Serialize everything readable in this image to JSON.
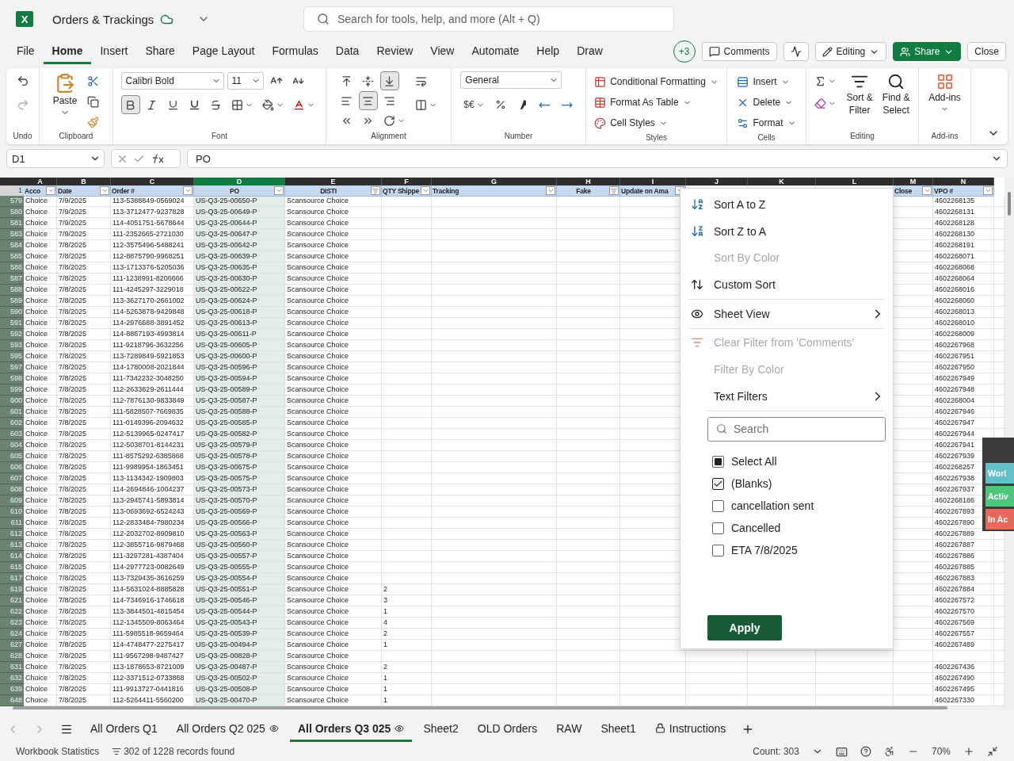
{
  "app": {
    "logo": "X",
    "title": "Orders & Trackings"
  },
  "search": {
    "placeholder": "Search for tools, help, and more (Alt + Q)"
  },
  "menu_tabs": [
    {
      "label": "File",
      "selected": false
    },
    {
      "label": "Home",
      "selected": true
    },
    {
      "label": "Insert",
      "selected": false
    },
    {
      "label": "Share",
      "selected": false
    },
    {
      "label": "Page Layout",
      "selected": false
    },
    {
      "label": "Formulas",
      "selected": false
    },
    {
      "label": "Data",
      "selected": false
    },
    {
      "label": "Review",
      "selected": false
    },
    {
      "label": "View",
      "selected": false
    },
    {
      "label": "Automate",
      "selected": false
    },
    {
      "label": "Help",
      "selected": false
    },
    {
      "label": "Draw",
      "selected": false
    }
  ],
  "actions": {
    "presence": "+3",
    "comments": "Comments",
    "editing": "Editing",
    "share": "Share",
    "close": "Close"
  },
  "ribbon": {
    "undo": {
      "label": "Undo"
    },
    "clipboard": {
      "paste": "Paste",
      "label": "Clipboard"
    },
    "font": {
      "name": "Calibri Bold",
      "size": "11",
      "bold": true,
      "label": "Font"
    },
    "alignment": {
      "vertical": [
        {
          "selected": false
        },
        {
          "selected": false
        },
        {
          "selected": true
        }
      ],
      "horizontal": [
        {
          "selected": false
        },
        {
          "selected": true
        },
        {
          "selected": false
        }
      ],
      "label": "Alignment"
    },
    "number": {
      "format": "General",
      "currency": "$€",
      "label": "Number"
    },
    "styles": {
      "items": [
        "Conditional Formatting",
        "Format As Table",
        "Cell Styles"
      ],
      "label": "Styles"
    },
    "cells": {
      "items": [
        "Insert",
        "Delete",
        "Format"
      ],
      "label": "Cells"
    },
    "editing": {
      "sort": [
        "Sort &",
        "Filter"
      ],
      "find": [
        "Find &",
        "Select"
      ],
      "label": "Editing"
    },
    "addins": {
      "button": "Add-ins",
      "label": "Add-ins"
    }
  },
  "formula_bar": {
    "name_box": "D1",
    "value": "PO"
  },
  "sheet": {
    "column_letters": [
      {
        "label": "A",
        "selected": false
      },
      {
        "label": "B",
        "selected": false
      },
      {
        "label": "C",
        "selected": false
      },
      {
        "label": "D",
        "selected": true
      },
      {
        "label": "E",
        "selected": false
      },
      {
        "label": "F",
        "selected": false
      },
      {
        "label": "G",
        "selected": false
      },
      {
        "label": "H",
        "selected": false
      },
      {
        "label": "I",
        "selected": false
      },
      {
        "label": "J",
        "selected": false
      },
      {
        "label": "K",
        "selected": false
      },
      {
        "label": "L",
        "selected": false
      },
      {
        "label": "M",
        "selected": false
      },
      {
        "label": "N",
        "selected": false
      }
    ],
    "header_row": "1",
    "headers": [
      {
        "kind": "text",
        "label": "Acco",
        "filtered": false
      },
      {
        "kind": "text",
        "label": "Date",
        "filtered": false
      },
      {
        "kind": "text",
        "label": "Order #",
        "filtered": false
      },
      {
        "kind": "text",
        "label": "PO",
        "filtered": false
      },
      {
        "kind": "text",
        "label": "DISTI",
        "filtered": true
      },
      {
        "kind": "text",
        "label": "QTY Shippe",
        "filtered": false
      },
      {
        "kind": "text",
        "label": "Tracking",
        "filtered": false
      },
      {
        "kind": "text",
        "label": "Fake",
        "filtered": true
      },
      {
        "kind": "text",
        "label": "Update on Ama",
        "filtered": false
      },
      {
        "kind": "covered"
      },
      {
        "kind": "covered"
      },
      {
        "kind": "covered"
      },
      {
        "kind": "text",
        "label": "Close",
        "filtered": false
      },
      {
        "kind": "text",
        "label": "VPO #",
        "filtered": false
      }
    ],
    "rows": [
      {
        "row": "579",
        "account": "Choice",
        "date": "7/9/2025",
        "order": "113-5388849-0569024",
        "po": "US-Q3-25-00650-P",
        "disti": "Scansource Choice",
        "vpo": "4602268135"
      },
      {
        "row": "580",
        "account": "Choice",
        "date": "7/9/2025",
        "order": "113-3712477-9237828",
        "po": "US-Q3-25-00649-P",
        "disti": "Scansource Choice",
        "vpo": "4602268131"
      },
      {
        "row": "581",
        "account": "Choice",
        "date": "7/9/2025",
        "order": "114-4051751-5678644",
        "po": "US-Q3-25-00644-P",
        "disti": "Scansource Choice",
        "vpo": "4602268128"
      },
      {
        "row": "583",
        "account": "Choice",
        "date": "7/9/2025",
        "order": "111-2352665-2721030",
        "po": "US-Q3-25-00647-P",
        "disti": "Scansource Choice",
        "vpo": "4602268130"
      },
      {
        "row": "584",
        "account": "Choice",
        "date": "7/8/2025",
        "order": "112-3575496-5488241",
        "po": "US-Q3-25-00642-P",
        "disti": "Scansource Choice",
        "vpo": "4602268191"
      },
      {
        "row": "585",
        "account": "Choice",
        "date": "7/8/2025",
        "order": "112-8875790-9968251",
        "po": "US-Q3-25-00639-P",
        "disti": "Scansource Choice",
        "vpo": "4602268071"
      },
      {
        "row": "586",
        "account": "Choice",
        "date": "7/8/2025",
        "order": "113-1713376-5205036",
        "po": "US-Q3-25-00635-P",
        "disti": "Scansource Choice",
        "vpo": "4602268068"
      },
      {
        "row": "587",
        "account": "Choice",
        "date": "7/8/2025",
        "order": "111-1238991-8206666",
        "po": "US-Q3-25-00630-P",
        "disti": "Scansource Choice",
        "vpo": "4602268064"
      },
      {
        "row": "588",
        "account": "Choice",
        "date": "7/8/2025",
        "order": "111-4245297-3229018",
        "po": "US-Q3-25-00622-P",
        "disti": "Scansource Choice",
        "vpo": "4602268016"
      },
      {
        "row": "589",
        "account": "Choice",
        "date": "7/8/2025",
        "order": "113-3627170-2661002",
        "po": "US-Q3-25-00624-P",
        "disti": "Scansource Choice",
        "vpo": "4602268060"
      },
      {
        "row": "590",
        "account": "Choice",
        "date": "7/8/2025",
        "order": "114-5263878-9429848",
        "po": "US-Q3-25-00618-P",
        "disti": "Scansource Choice",
        "vpo": "4602268013"
      },
      {
        "row": "591",
        "account": "Choice",
        "date": "7/8/2025",
        "order": "114-2976688-3891452",
        "po": "US-Q3-25-00613-P",
        "disti": "Scansource Choice",
        "vpo": "4602268010"
      },
      {
        "row": "592",
        "account": "Choice",
        "date": "7/8/2025",
        "order": "114-8867193-4993814",
        "po": "US-Q3-25-00611-P",
        "disti": "Scansource Choice",
        "vpo": "4602268009"
      },
      {
        "row": "593",
        "account": "Choice",
        "date": "7/8/2025",
        "order": "111-9218796-3632256",
        "po": "US-Q3-25-00605-P",
        "disti": "Scansource Choice",
        "vpo": "4602267968"
      },
      {
        "row": "595",
        "account": "Choice",
        "date": "7/8/2025",
        "order": "113-7289849-5921853",
        "po": "US-Q3-25-00600-P",
        "disti": "Scansource Choice",
        "vpo": "4602267951"
      },
      {
        "row": "597",
        "account": "Choice",
        "date": "7/8/2025",
        "order": "114-1780008-2021844",
        "po": "US-Q3-25-00596-P",
        "disti": "Scansource Choice",
        "vpo": "4602267950"
      },
      {
        "row": "598",
        "account": "Choice",
        "date": "7/8/2025",
        "order": "111-7342232-3048250",
        "po": "US-Q3-25-00594-P",
        "disti": "Scansource Choice",
        "vpo": "4602267949"
      },
      {
        "row": "599",
        "account": "Choice",
        "date": "7/8/2025",
        "order": "112-2633829-2611444",
        "po": "US-Q3-25-00589-P",
        "disti": "Scansource Choice",
        "vpo": "4602267948"
      },
      {
        "row": "600",
        "account": "Choice",
        "date": "7/8/2025",
        "order": "112-7876130-9833849",
        "po": "US-Q3-25-00587-P",
        "disti": "Scansource Choice",
        "vpo": "4602268004"
      },
      {
        "row": "601",
        "account": "Choice",
        "date": "7/8/2025",
        "order": "111-5828507-7669835",
        "po": "US-Q3-25-00588-P",
        "disti": "Scansource Choice",
        "vpo": "4602267946"
      },
      {
        "row": "602",
        "account": "Choice",
        "date": "7/8/2025",
        "order": "111-0149396-2094632",
        "po": "US-Q3-25-00585-P",
        "disti": "Scansource Choice",
        "vpo": "4602267947"
      },
      {
        "row": "603",
        "account": "Choice",
        "date": "7/8/2025",
        "order": "112-5139965-0247417",
        "po": "US-Q3-25-00582-P",
        "disti": "Scansource Choice",
        "vpo": "4602267944"
      },
      {
        "row": "604",
        "account": "Choice",
        "date": "7/8/2025",
        "order": "112-5038701-8144231",
        "po": "US-Q3-25-00579-P",
        "disti": "Scansource Choice",
        "vpo": "4602267941"
      },
      {
        "row": "605",
        "account": "Choice",
        "date": "7/8/2025",
        "order": "111-8575292-6385868",
        "po": "US-Q3-25-00578-P",
        "disti": "Scansource Choice",
        "vpo": "4602267939"
      },
      {
        "row": "606",
        "account": "Choice",
        "date": "7/8/2025",
        "order": "111-9989954-1863451",
        "po": "US-Q3-25-00675-P",
        "disti": "Scansource Choice",
        "vpo": "4602268257"
      },
      {
        "row": "607",
        "account": "Choice",
        "date": "7/8/2025",
        "order": "113-1134342-1909803",
        "po": "US-Q3-25-00575-P",
        "disti": "Scansource Choice",
        "vpo": "4602267938"
      },
      {
        "row": "608",
        "account": "Choice",
        "date": "7/8/2025",
        "order": "114-2694846-1004237",
        "po": "US-Q3-25-00573-P",
        "disti": "Scansource Choice",
        "vpo": "4602267937"
      },
      {
        "row": "609",
        "account": "Choice",
        "date": "7/8/2025",
        "order": "113-2945741-5893814",
        "po": "US-Q3-25-00570-P",
        "disti": "Scansource Choice",
        "vpo": "4602268186"
      },
      {
        "row": "610",
        "account": "Choice",
        "date": "7/8/2025",
        "order": "113-0693692-6524243",
        "po": "US-Q3-25-00569-P",
        "disti": "Scansource Choice",
        "vpo": "4602267893"
      },
      {
        "row": "611",
        "account": "Choice",
        "date": "7/8/2025",
        "order": "112-2833484-7980234",
        "po": "US-Q3-25-00566-P",
        "disti": "Scansource Choice",
        "vpo": "4602267890"
      },
      {
        "row": "612",
        "account": "Choice",
        "date": "7/8/2025",
        "order": "112-2032702-8909810",
        "po": "US-Q3-25-00563-P",
        "disti": "Scansource Choice",
        "vpo": "4602267889"
      },
      {
        "row": "613",
        "account": "Choice",
        "date": "7/8/2025",
        "order": "112-3855716-9879468",
        "po": "US-Q3-25-00560-P",
        "disti": "Scansource Choice",
        "vpo": "4602267887"
      },
      {
        "row": "614",
        "account": "Choice",
        "date": "7/8/2025",
        "order": "111-3297281-4387404",
        "po": "US-Q3-25-00557-P",
        "disti": "Scansource Choice",
        "vpo": "4602267886"
      },
      {
        "row": "615",
        "account": "Choice",
        "date": "7/8/2025",
        "order": "114-2977723-0082649",
        "po": "US-Q3-25-00555-P",
        "disti": "Scansource Choice",
        "vpo": "4602267885"
      },
      {
        "row": "617",
        "account": "Choice",
        "date": "7/8/2025",
        "order": "113-7329435-3616259",
        "po": "US-Q3-25-00554-P",
        "disti": "Scansource Choice",
        "vpo": "4602267883"
      },
      {
        "row": "619",
        "account": "Choice",
        "date": "7/8/2025",
        "order": "114-5631024-8885828",
        "po": "US-Q3-25-00551-P",
        "disti": "Scansource Choice",
        "qty": "2",
        "vpo": "4602267884"
      },
      {
        "row": "621",
        "account": "Choice",
        "date": "7/8/2025",
        "order": "114-7346916-1746618",
        "po": "US-Q3-25-00546-P",
        "disti": "Scansource Choice",
        "qty": "3",
        "vpo": "4602267572"
      },
      {
        "row": "622",
        "account": "Choice",
        "date": "7/8/2025",
        "order": "113-3844501-4815454",
        "po": "US-Q3-25-00544-P",
        "disti": "Scansource Choice",
        "qty": "1",
        "vpo": "4602267570"
      },
      {
        "row": "623",
        "account": "Choice",
        "date": "7/8/2025",
        "order": "112-1345509-8063464",
        "po": "US-Q3-25-00543-P",
        "disti": "Scansource Choice",
        "qty": "4",
        "vpo": "4602267569"
      },
      {
        "row": "624",
        "account": "Choice",
        "date": "7/8/2025",
        "order": "111-5985518-9659464",
        "po": "US-Q3-25-00539-P",
        "disti": "Scansource Choice",
        "qty": "2",
        "vpo": "4602267557"
      },
      {
        "row": "627",
        "account": "Choice",
        "date": "7/8/2025",
        "order": "114-4748477-2275417",
        "po": "US-Q3-25-00494-P",
        "disti": "Scansource Choice",
        "qty": "1",
        "vpo": "4602267489"
      },
      {
        "row": "628",
        "account": "Choice",
        "date": "7/8/2025",
        "order": "111-9567298-9487427",
        "po": "US-Q3-25-00828-P",
        "disti": "Scansource Choice"
      },
      {
        "row": "631",
        "account": "Choice",
        "date": "7/8/2025",
        "order": "113-1878653-8721009",
        "po": "US-Q3-25-00487-P",
        "disti": "Scansource Choice",
        "qty": "2",
        "vpo": "4602267436"
      },
      {
        "row": "632",
        "account": "Choice",
        "date": "7/8/2025",
        "order": "112-3371512-0733868",
        "po": "US-Q3-25-00502-P",
        "disti": "Scansource Choice",
        "qty": "1",
        "vpo": "4602267490"
      },
      {
        "row": "639",
        "account": "Choice",
        "date": "7/8/2025",
        "order": "111-9913727-0441816",
        "po": "US-Q3-25-00508-P",
        "disti": "Scansource Choice",
        "qty": "1",
        "vpo": "4602267495"
      },
      {
        "row": "648",
        "account": "Choice",
        "date": "7/8/2025",
        "order": "112-5264411-5560200",
        "po": "US-Q3-25-00470-P",
        "disti": "Scansource Choice",
        "qty": "1",
        "vpo": "4602267330"
      }
    ]
  },
  "filter_menu": {
    "sections": [
      [
        {
          "label": "Sort A to Z",
          "kind": "sort-az",
          "disabled": false
        },
        {
          "label": "Sort Z to A",
          "kind": "sort-za",
          "disabled": false
        },
        {
          "label": "Sort By Color",
          "kind": "plain",
          "disabled": true
        },
        {
          "label": "Custom Sort",
          "kind": "custom",
          "disabled": false
        }
      ],
      [
        {
          "label": "Sheet View",
          "kind": "view",
          "disabled": false
        }
      ],
      [
        {
          "label": "Clear Filter from 'Comments'",
          "kind": "clear",
          "disabled": true
        },
        {
          "label": "Filter By Color",
          "kind": "plain",
          "disabled": true
        },
        {
          "label": "Text Filters",
          "kind": "submenu",
          "disabled": false
        }
      ]
    ],
    "search_placeholder": "Search",
    "values": [
      {
        "label": "Select All",
        "checked": false,
        "partial": true
      },
      {
        "label": "(Blanks)",
        "checked": true,
        "partial": false
      },
      {
        "label": "cancellation sent",
        "checked": false,
        "partial": false
      },
      {
        "label": "Cancelled",
        "checked": false,
        "partial": false
      },
      {
        "label": "ETA 7/8/2025",
        "checked": false,
        "partial": false
      }
    ],
    "apply": "Apply"
  },
  "side_panel": {
    "buttons": [
      {
        "label": "Worl",
        "color": "#62c0c9"
      },
      {
        "label": "Activ",
        "color": "#4ec77c"
      },
      {
        "label": "In Ac",
        "color": "#e8695c"
      }
    ]
  },
  "sheet_tabs": [
    {
      "label": "All Orders Q1",
      "kind": "plain",
      "selected": false
    },
    {
      "label": "All Orders Q2 025",
      "kind": "view",
      "selected": false
    },
    {
      "label": "All Orders Q3 025",
      "kind": "view",
      "selected": true
    },
    {
      "label": "Sheet2",
      "kind": "plain",
      "selected": false
    },
    {
      "label": "OLD Orders",
      "kind": "plain",
      "selected": false
    },
    {
      "label": "RAW",
      "kind": "plain",
      "selected": false
    },
    {
      "label": "Sheet1",
      "kind": "plain",
      "selected": false
    },
    {
      "label": "Instructions",
      "kind": "locked",
      "selected": false
    }
  ],
  "status_bar": {
    "stats": "Workbook Statistics",
    "records": "302 of 1228 records found",
    "count": "Count: 303",
    "zoom": "70%"
  }
}
